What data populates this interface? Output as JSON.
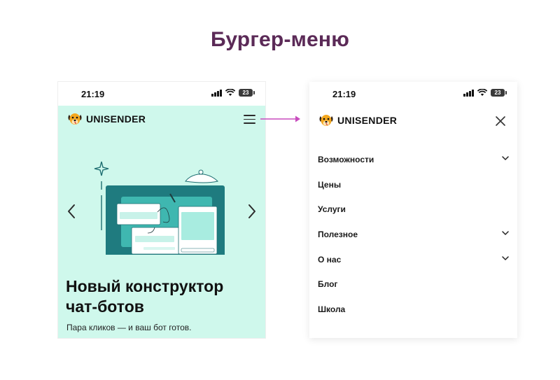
{
  "heading": "Бургер-меню",
  "left_screen": {
    "status_time": "21:19",
    "battery": "23",
    "brand": "UNISENDER",
    "hero_title_line1": "Новый конструктор",
    "hero_title_line2": "чат-ботов",
    "hero_subtitle": "Пара кликов — и ваш бот готов."
  },
  "right_screen": {
    "status_time": "21:19",
    "battery": "23",
    "brand": "UNISENDER",
    "menu_items": [
      {
        "label": "Возможности",
        "has_chevron": true
      },
      {
        "label": "Цены",
        "has_chevron": false
      },
      {
        "label": "Услуги",
        "has_chevron": false
      },
      {
        "label": "Полезное",
        "has_chevron": true
      },
      {
        "label": "О нас",
        "has_chevron": true
      },
      {
        "label": "Блог",
        "has_chevron": false
      },
      {
        "label": "Школа",
        "has_chevron": false
      }
    ]
  },
  "colors": {
    "heading": "#5b2a57",
    "hero_background": "#cff8ec",
    "connector_arrow": "#c84bbd",
    "illustration_dark": "#1f7b7f",
    "illustration_mid": "#3fb7b0"
  },
  "icons": {
    "logo": "dog-logo-icon",
    "burger": "burger-menu-icon",
    "close": "close-icon",
    "chevron": "chevron-down-icon",
    "prev": "chevron-left-icon",
    "next": "chevron-right-icon"
  }
}
